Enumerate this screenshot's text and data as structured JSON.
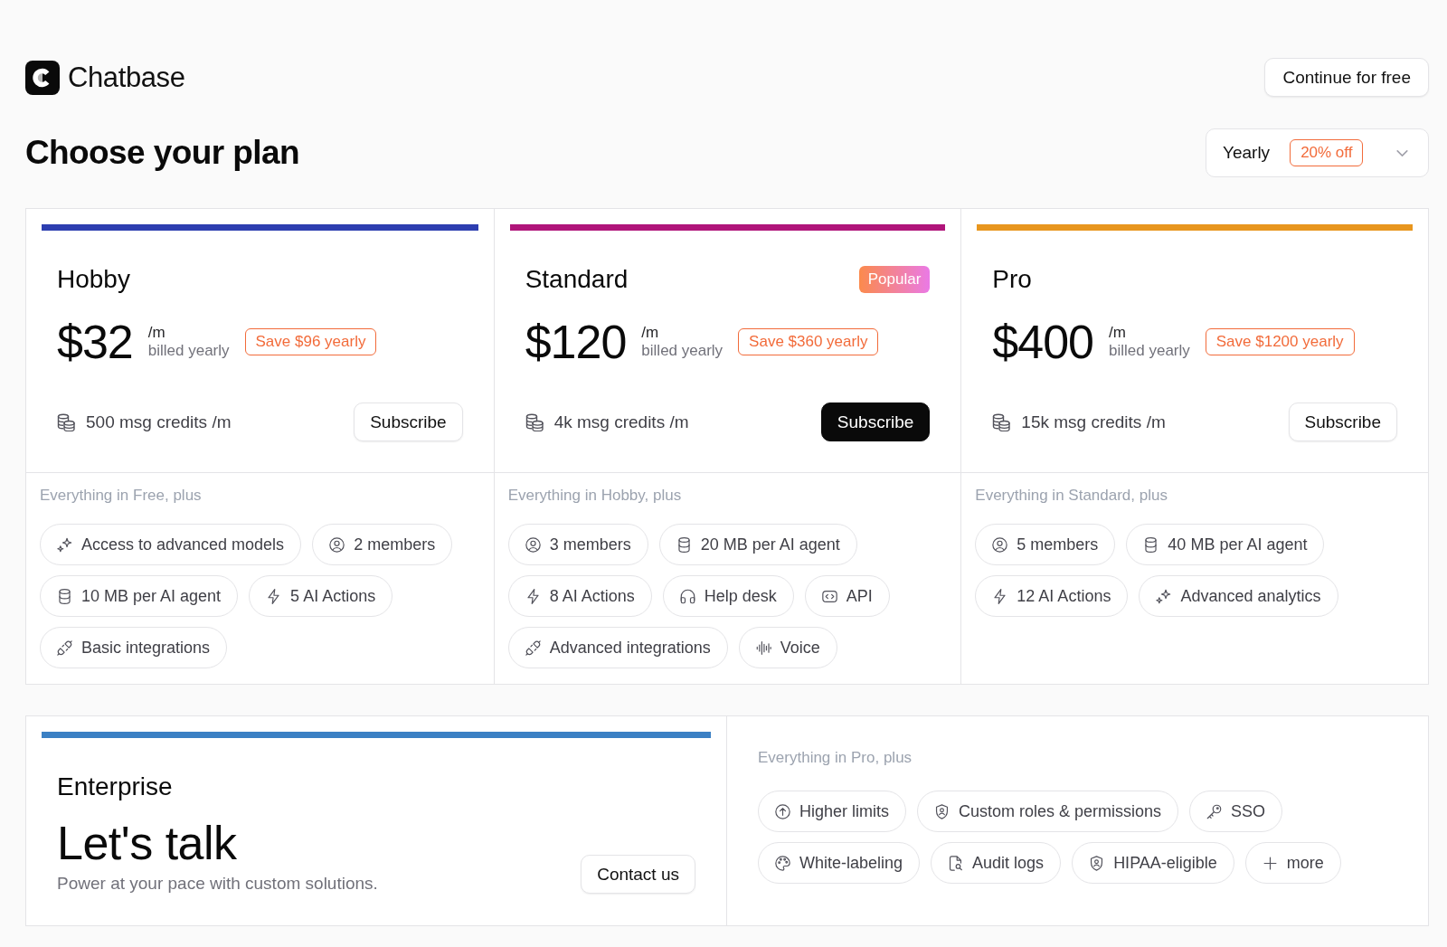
{
  "header": {
    "brand": "Chatbase",
    "continue_button": "Continue for free"
  },
  "title": "Choose your plan",
  "billing_period": {
    "value": "Yearly",
    "badge": "20% off"
  },
  "plans": [
    {
      "name": "Hobby",
      "color": "#2d3eb0",
      "price": "$32",
      "period": "/m",
      "billing_note": "billed yearly",
      "savings": "Save $96 yearly",
      "credits": "500 msg credits /m",
      "subscribe": {
        "label": "Subscribe",
        "primary": false
      },
      "features_title": "Everything in Free, plus",
      "features": [
        {
          "kind": "models",
          "label": "Access to advanced models"
        },
        {
          "kind": "members",
          "label": "2 members"
        },
        {
          "kind": "storage",
          "label": "10 MB per AI agent"
        },
        {
          "kind": "actions",
          "label": "5 AI Actions"
        },
        {
          "kind": "integrations",
          "label": "Basic integrations"
        }
      ]
    },
    {
      "name": "Standard",
      "badge": "Popular",
      "color": "#b0157a",
      "price": "$120",
      "period": "/m",
      "billing_note": "billed yearly",
      "savings": "Save $360 yearly",
      "credits": "4k msg credits /m",
      "subscribe": {
        "label": "Subscribe",
        "primary": true
      },
      "features_title": "Everything in Hobby, plus",
      "features": [
        {
          "kind": "members",
          "label": "3 members"
        },
        {
          "kind": "storage",
          "label": "20 MB per AI agent"
        },
        {
          "kind": "actions",
          "label": "8 AI Actions"
        },
        {
          "kind": "helpdesk",
          "label": "Help desk"
        },
        {
          "kind": "api",
          "label": "API"
        },
        {
          "kind": "integrations",
          "label": "Advanced integrations"
        },
        {
          "kind": "voice",
          "label": "Voice"
        }
      ]
    },
    {
      "name": "Pro",
      "color": "#e8961e",
      "price": "$400",
      "period": "/m",
      "billing_note": "billed yearly",
      "savings": "Save $1200 yearly",
      "credits": "15k msg credits /m",
      "subscribe": {
        "label": "Subscribe",
        "primary": false
      },
      "features_title": "Everything in Standard, plus",
      "features": [
        {
          "kind": "members",
          "label": "5 members"
        },
        {
          "kind": "storage",
          "label": "40 MB per AI agent"
        },
        {
          "kind": "actions",
          "label": "12 AI Actions"
        },
        {
          "kind": "analytics",
          "label": "Advanced analytics"
        }
      ]
    }
  ],
  "enterprise": {
    "name": "Enterprise",
    "color": "#3b80c4",
    "price": "Let's talk",
    "description": "Power at your pace with custom solutions.",
    "contact_button": "Contact us",
    "features_title": "Everything in Pro, plus",
    "features": [
      {
        "kind": "limits",
        "label": "Higher limits"
      },
      {
        "kind": "roles",
        "label": "Custom roles & permissions"
      },
      {
        "kind": "sso",
        "label": "SSO"
      },
      {
        "kind": "branding",
        "label": "White-labeling"
      },
      {
        "kind": "audit",
        "label": "Audit logs"
      },
      {
        "kind": "compliance",
        "label": "HIPAA-eligible"
      },
      {
        "kind": "more",
        "label": "more"
      }
    ]
  }
}
